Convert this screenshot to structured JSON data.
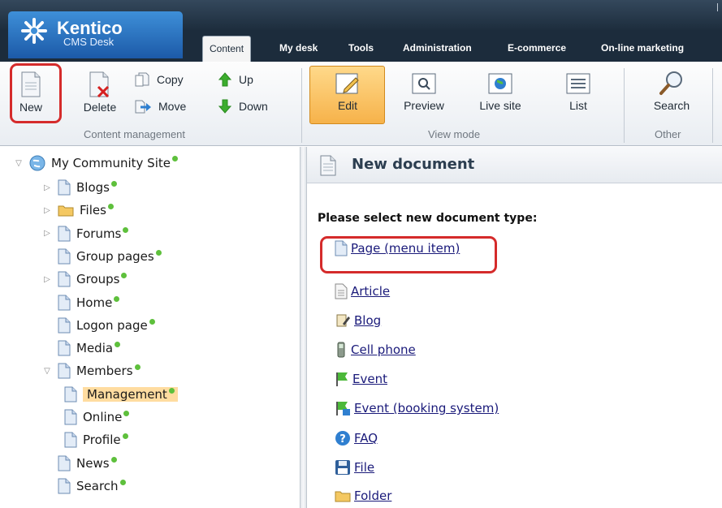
{
  "app": {
    "brand_title": "Kentico",
    "brand_sub": "CMS Desk"
  },
  "tabs": [
    {
      "label": "Content",
      "active": true
    },
    {
      "label": "My desk"
    },
    {
      "label": "Tools"
    },
    {
      "label": "Administration"
    },
    {
      "label": "E-commerce"
    },
    {
      "label": "On-line marketing"
    }
  ],
  "ribbon": {
    "new_label": "New",
    "delete_label": "Delete",
    "copy_label": "Copy",
    "move_label": "Move",
    "up_label": "Up",
    "down_label": "Down",
    "group_content": "Content management",
    "edit_label": "Edit",
    "preview_label": "Preview",
    "livesite_label": "Live site",
    "list_label": "List",
    "group_view": "View mode",
    "search_label": "Search",
    "group_other": "Other"
  },
  "tree": {
    "root": "My Community Site",
    "items": [
      {
        "label": "Blogs",
        "expandable": true,
        "icon": "page"
      },
      {
        "label": "Files",
        "expandable": true,
        "icon": "folder"
      },
      {
        "label": "Forums",
        "expandable": true,
        "icon": "page"
      },
      {
        "label": "Group pages",
        "expandable": false,
        "icon": "page"
      },
      {
        "label": "Groups",
        "expandable": true,
        "icon": "page"
      },
      {
        "label": "Home",
        "expandable": false,
        "icon": "page"
      },
      {
        "label": "Logon page",
        "expandable": false,
        "icon": "page"
      },
      {
        "label": "Media",
        "expandable": false,
        "icon": "page"
      },
      {
        "label": "Members",
        "expandable": true,
        "expanded": true,
        "icon": "page"
      },
      {
        "label": "Management",
        "child": true,
        "selected": true,
        "icon": "page"
      },
      {
        "label": "Online",
        "child": true,
        "icon": "page"
      },
      {
        "label": "Profile",
        "child": true,
        "icon": "page"
      },
      {
        "label": "News",
        "expandable": false,
        "icon": "page"
      },
      {
        "label": "Search",
        "expandable": false,
        "icon": "page"
      }
    ],
    "status_color": "#5ec03c"
  },
  "main": {
    "title": "New document",
    "prompt": "Please select new document type:",
    "doc_types": [
      {
        "label": "Page (menu item)",
        "icon": "page-icon"
      },
      {
        "label": "Article",
        "icon": "article-icon"
      },
      {
        "label": "Blog",
        "icon": "blog-icon"
      },
      {
        "label": "Cell phone",
        "icon": "cellphone-icon"
      },
      {
        "label": "Event",
        "icon": "flag-icon"
      },
      {
        "label": "Event (booking system)",
        "icon": "flag-booking-icon"
      },
      {
        "label": "FAQ",
        "icon": "help-icon"
      },
      {
        "label": "File",
        "icon": "floppy-icon"
      },
      {
        "label": "Folder",
        "icon": "folder-icon"
      }
    ]
  },
  "colors": {
    "header_bg": "#1c2c3c",
    "logo_blue": "#2f7fd0",
    "highlight": "#d52b2b",
    "edit_active": "#f6b24a",
    "selected_node": "#ffdca0"
  }
}
